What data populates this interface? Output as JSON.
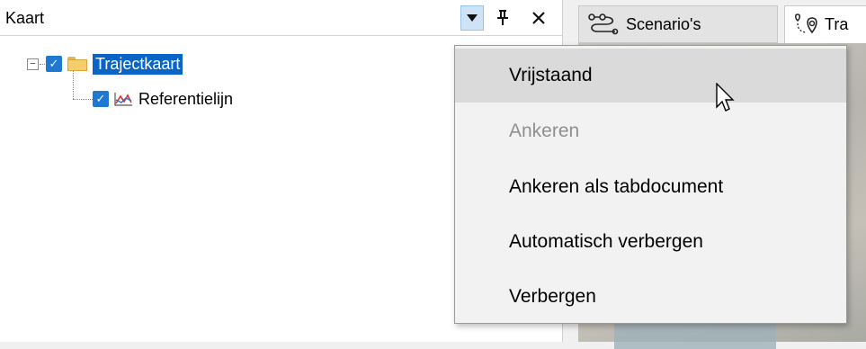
{
  "panel": {
    "title": "Kaart",
    "buttons": {
      "dropdown_icon": "dropdown-arrow-icon",
      "pin_icon": "pin-icon",
      "close_icon": "close-icon"
    }
  },
  "tree": {
    "root": {
      "label": "Trajectkaart",
      "checked": true,
      "expanded": true,
      "selected": true,
      "icon": "folder-icon"
    },
    "child": {
      "label": "Referentielijn",
      "checked": true,
      "icon": "line-chart-icon"
    }
  },
  "tabs": [
    {
      "label": "Scenario's",
      "icon": "scenario-icon",
      "active": false
    },
    {
      "label": "Tra",
      "icon": "map-pin-icon",
      "active": true
    }
  ],
  "context_menu": {
    "items": [
      {
        "label": "Vrijstaand",
        "state": "hover"
      },
      {
        "label": "Ankeren",
        "state": "disabled"
      },
      {
        "label": "Ankeren als tabdocument",
        "state": "normal"
      },
      {
        "label": "Automatisch verbergen",
        "state": "normal"
      },
      {
        "label": "Verbergen",
        "state": "normal"
      }
    ]
  },
  "colors": {
    "selection": "#0a64c6",
    "checkbox": "#1f78d1",
    "menu_hover": "#dadada"
  }
}
